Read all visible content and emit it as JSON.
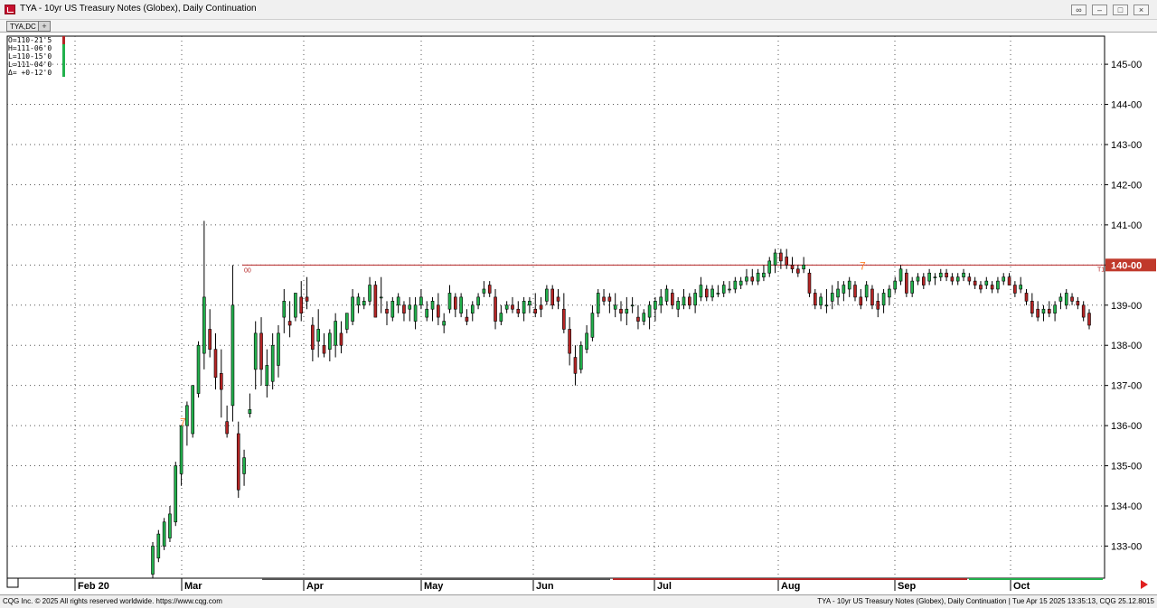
{
  "window": {
    "title": "TYA - 10yr US Treasury Notes (Globex), Daily Continuation",
    "tab_label": "TYA,DC",
    "tab_add_label": "+"
  },
  "ohlc_readout": [
    "O=110-21'5",
    "H=111-06'0",
    "L=110-15'0",
    "L=111-04'0",
    "Δ= +0-12'0"
  ],
  "status": {
    "left": "CQG Inc. © 2025 All rights reserved worldwide. https://www.cqg.com",
    "right": "TYA - 10yr US Treasury Notes (Globex), Daily Continuation | Tue Apr 15 2025 13:35:13, CQG 25.12.8015"
  },
  "colors": {
    "up": "#22b14c",
    "down": "#b52525",
    "line": "#b52525",
    "price_tag": "#c0392b",
    "annotation": "#ff7f27",
    "grid": "#555555"
  },
  "chart_data": {
    "type": "candlestick",
    "title": "",
    "xlabel": "",
    "ylabel": "",
    "ylim": [
      132.2,
      145.7
    ],
    "y_ticks": [
      "133-00",
      "134-00",
      "135-00",
      "136-00",
      "137-00",
      "138-00",
      "139-00",
      "140-00",
      "141-00",
      "142-00",
      "143-00",
      "144-00",
      "145-00"
    ],
    "x_labels": [
      "Feb 20",
      "Mar",
      "Apr",
      "May",
      "Jun",
      "Jul",
      "Aug",
      "Sep",
      "Oct"
    ],
    "grid": true,
    "horizontal_line": {
      "value": 140.0,
      "label": "140-00",
      "left_label": "00",
      "right_label": "T1"
    },
    "annotations": [
      {
        "text": "7",
        "near": "mid Mar",
        "value": 136.1
      },
      {
        "text": "7",
        "near": "mid Aug",
        "value": 140.0
      }
    ],
    "candles": [
      [
        132.3,
        133.1,
        132.2,
        133.0
      ],
      [
        132.7,
        133.4,
        132.6,
        133.3
      ],
      [
        133.0,
        133.7,
        132.9,
        133.6
      ],
      [
        133.2,
        134.0,
        133.1,
        133.8
      ],
      [
        133.6,
        135.1,
        133.5,
        135.0
      ],
      [
        134.8,
        136.0,
        134.5,
        136.0
      ],
      [
        136.0,
        136.6,
        135.5,
        136.5
      ],
      [
        135.8,
        137.0,
        135.7,
        137.0
      ],
      [
        136.8,
        138.1,
        136.7,
        138.0
      ],
      [
        137.8,
        141.1,
        137.4,
        139.2
      ],
      [
        138.4,
        138.9,
        137.7,
        137.9
      ],
      [
        137.9,
        138.3,
        136.9,
        137.2
      ],
      [
        137.3,
        137.9,
        136.2,
        136.9
      ],
      [
        136.1,
        136.5,
        135.7,
        135.8
      ],
      [
        136.5,
        140.0,
        136.1,
        139.0
      ],
      [
        135.8,
        136.1,
        134.2,
        134.4
      ],
      [
        134.8,
        135.4,
        134.5,
        135.2
      ],
      [
        136.3,
        136.8,
        136.2,
        136.4
      ],
      [
        137.4,
        138.6,
        136.9,
        138.3
      ],
      [
        138.3,
        138.7,
        137.0,
        137.4
      ],
      [
        137.0,
        137.9,
        136.7,
        137.5
      ],
      [
        137.1,
        138.3,
        136.9,
        138.0
      ],
      [
        137.5,
        138.5,
        137.2,
        138.3
      ],
      [
        138.7,
        139.4,
        138.3,
        139.1
      ],
      [
        138.6,
        139.1,
        138.2,
        138.5
      ],
      [
        138.7,
        139.3,
        138.6,
        139.3
      ],
      [
        139.2,
        139.6,
        138.6,
        138.8
      ],
      [
        139.2,
        139.7,
        138.9,
        139.1
      ],
      [
        138.5,
        138.7,
        137.6,
        137.9
      ],
      [
        138.1,
        138.9,
        137.7,
        138.4
      ],
      [
        138.0,
        138.3,
        137.7,
        137.8
      ],
      [
        137.9,
        138.4,
        137.6,
        138.3
      ],
      [
        138.0,
        138.8,
        137.7,
        138.6
      ],
      [
        138.3,
        138.6,
        137.8,
        138.0
      ],
      [
        138.4,
        138.8,
        138.3,
        138.8
      ],
      [
        138.6,
        139.4,
        138.5,
        139.2
      ],
      [
        139.0,
        139.3,
        138.8,
        139.2
      ],
      [
        139.0,
        139.2,
        138.9,
        139.1
      ],
      [
        139.1,
        139.7,
        139.0,
        139.5
      ],
      [
        139.5,
        139.6,
        138.7,
        138.7
      ],
      [
        139.2,
        139.7,
        138.8,
        139.2
      ],
      [
        138.9,
        139.1,
        138.5,
        138.8
      ],
      [
        138.7,
        139.2,
        138.6,
        139.1
      ],
      [
        139.0,
        139.3,
        138.8,
        139.2
      ],
      [
        139.0,
        139.1,
        138.6,
        138.8
      ],
      [
        138.9,
        139.2,
        138.6,
        139.0
      ],
      [
        138.6,
        139.2,
        138.4,
        139.0
      ],
      [
        139.0,
        139.4,
        138.9,
        139.2
      ],
      [
        138.7,
        139.1,
        138.6,
        138.9
      ],
      [
        138.9,
        139.2,
        138.6,
        139.1
      ],
      [
        139.0,
        139.3,
        138.5,
        138.7
      ],
      [
        138.5,
        138.8,
        138.3,
        138.6
      ],
      [
        138.9,
        139.5,
        138.8,
        139.3
      ],
      [
        139.2,
        139.3,
        138.7,
        138.9
      ],
      [
        138.8,
        139.3,
        138.7,
        139.2
      ],
      [
        138.7,
        138.9,
        138.5,
        138.6
      ],
      [
        138.8,
        139.1,
        138.6,
        139.0
      ],
      [
        139.0,
        139.3,
        138.9,
        139.2
      ],
      [
        139.3,
        139.6,
        139.2,
        139.4
      ],
      [
        139.5,
        139.6,
        139.2,
        139.3
      ],
      [
        139.2,
        139.4,
        138.4,
        138.6
      ],
      [
        138.6,
        139.0,
        138.5,
        138.8
      ],
      [
        138.9,
        139.1,
        138.8,
        139.0
      ],
      [
        139.0,
        139.2,
        138.8,
        138.9
      ],
      [
        138.9,
        139.1,
        138.7,
        138.8
      ],
      [
        138.8,
        139.2,
        138.6,
        139.1
      ],
      [
        139.0,
        139.2,
        138.8,
        139.1
      ],
      [
        138.9,
        139.3,
        138.7,
        138.8
      ],
      [
        139.0,
        139.2,
        138.7,
        138.9
      ],
      [
        139.1,
        139.5,
        139.0,
        139.4
      ],
      [
        139.4,
        139.5,
        138.9,
        139.0
      ],
      [
        139.2,
        139.4,
        138.9,
        139.1
      ],
      [
        138.9,
        139.3,
        138.3,
        138.4
      ],
      [
        138.4,
        138.7,
        137.5,
        137.8
      ],
      [
        137.7,
        138.0,
        137.0,
        137.3
      ],
      [
        137.4,
        138.1,
        137.3,
        138.0
      ],
      [
        137.9,
        138.5,
        137.8,
        138.3
      ],
      [
        138.2,
        139.0,
        138.1,
        138.8
      ],
      [
        138.8,
        139.4,
        138.7,
        139.3
      ],
      [
        139.2,
        139.4,
        139.0,
        139.1
      ],
      [
        139.2,
        139.3,
        138.8,
        139.1
      ],
      [
        138.9,
        139.3,
        138.7,
        139.0
      ],
      [
        138.9,
        139.1,
        138.6,
        138.8
      ],
      [
        138.8,
        139.2,
        138.5,
        138.9
      ],
      [
        139.0,
        139.2,
        138.8,
        139.0
      ],
      [
        138.7,
        139.0,
        138.4,
        138.6
      ],
      [
        138.6,
        138.9,
        138.5,
        138.8
      ],
      [
        138.7,
        139.1,
        138.4,
        139.0
      ],
      [
        138.9,
        139.2,
        138.6,
        139.1
      ],
      [
        139.0,
        139.4,
        138.8,
        139.2
      ],
      [
        139.1,
        139.5,
        139.0,
        139.4
      ],
      [
        139.3,
        139.4,
        138.9,
        139.0
      ],
      [
        138.9,
        139.2,
        138.7,
        139.1
      ],
      [
        139.0,
        139.4,
        138.9,
        139.2
      ],
      [
        139.2,
        139.3,
        138.9,
        139.0
      ],
      [
        139.0,
        139.4,
        138.8,
        139.3
      ],
      [
        139.2,
        139.7,
        139.1,
        139.5
      ],
      [
        139.4,
        139.5,
        139.1,
        139.2
      ],
      [
        139.2,
        139.5,
        139.1,
        139.4
      ],
      [
        139.3,
        139.5,
        139.2,
        139.3
      ],
      [
        139.3,
        139.6,
        139.2,
        139.5
      ],
      [
        139.4,
        139.6,
        139.3,
        139.4
      ],
      [
        139.4,
        139.7,
        139.3,
        139.6
      ],
      [
        139.5,
        139.7,
        139.4,
        139.6
      ],
      [
        139.6,
        139.9,
        139.5,
        139.7
      ],
      [
        139.7,
        139.9,
        139.5,
        139.6
      ],
      [
        139.6,
        139.9,
        139.5,
        139.8
      ],
      [
        139.7,
        140.0,
        139.6,
        139.8
      ],
      [
        139.8,
        140.2,
        139.7,
        140.1
      ],
      [
        140.0,
        140.4,
        139.8,
        140.3
      ],
      [
        140.3,
        140.4,
        139.9,
        140.1
      ],
      [
        140.2,
        140.4,
        139.9,
        140.0
      ],
      [
        140.0,
        140.2,
        139.8,
        139.9
      ],
      [
        139.9,
        140.0,
        139.7,
        139.8
      ],
      [
        139.9,
        140.2,
        139.8,
        140.0
      ],
      [
        139.8,
        139.9,
        139.2,
        139.3
      ],
      [
        139.3,
        139.4,
        138.9,
        139.0
      ],
      [
        139.0,
        139.3,
        138.9,
        139.2
      ],
      [
        139.0,
        139.4,
        138.8,
        139.0
      ],
      [
        139.1,
        139.5,
        138.9,
        139.3
      ],
      [
        139.2,
        139.6,
        139.0,
        139.4
      ],
      [
        139.3,
        139.6,
        139.1,
        139.5
      ],
      [
        139.4,
        139.7,
        139.2,
        139.6
      ],
      [
        139.5,
        139.6,
        139.1,
        139.2
      ],
      [
        139.2,
        139.4,
        138.9,
        139.0
      ],
      [
        139.2,
        139.6,
        139.1,
        139.5
      ],
      [
        139.4,
        139.5,
        138.9,
        139.0
      ],
      [
        139.1,
        139.3,
        138.7,
        138.9
      ],
      [
        139.0,
        139.4,
        138.8,
        139.3
      ],
      [
        139.2,
        139.5,
        139.0,
        139.4
      ],
      [
        139.4,
        139.7,
        139.3,
        139.6
      ],
      [
        139.6,
        140.0,
        139.5,
        139.9
      ],
      [
        139.8,
        139.9,
        139.2,
        139.3
      ],
      [
        139.3,
        139.7,
        139.2,
        139.6
      ],
      [
        139.6,
        139.8,
        139.5,
        139.7
      ],
      [
        139.7,
        139.8,
        139.4,
        139.5
      ],
      [
        139.6,
        139.9,
        139.5,
        139.8
      ],
      [
        139.7,
        139.8,
        139.5,
        139.7
      ],
      [
        139.7,
        139.9,
        139.6,
        139.8
      ],
      [
        139.8,
        139.9,
        139.6,
        139.7
      ],
      [
        139.7,
        139.8,
        139.5,
        139.6
      ],
      [
        139.6,
        139.8,
        139.5,
        139.7
      ],
      [
        139.7,
        139.9,
        139.6,
        139.8
      ],
      [
        139.7,
        139.8,
        139.5,
        139.6
      ],
      [
        139.6,
        139.7,
        139.4,
        139.5
      ],
      [
        139.5,
        139.6,
        139.3,
        139.4
      ],
      [
        139.5,
        139.7,
        139.4,
        139.6
      ],
      [
        139.5,
        139.6,
        139.3,
        139.4
      ],
      [
        139.4,
        139.7,
        139.3,
        139.6
      ],
      [
        139.6,
        139.8,
        139.5,
        139.7
      ],
      [
        139.7,
        139.8,
        139.5,
        139.5
      ],
      [
        139.5,
        139.6,
        139.2,
        139.3
      ],
      [
        139.4,
        139.7,
        139.3,
        139.5
      ],
      [
        139.3,
        139.4,
        139.0,
        139.1
      ],
      [
        139.1,
        139.3,
        138.7,
        138.8
      ],
      [
        138.9,
        139.1,
        138.6,
        138.7
      ],
      [
        138.8,
        139.0,
        138.6,
        138.9
      ],
      [
        138.9,
        139.1,
        138.7,
        138.8
      ],
      [
        138.8,
        139.1,
        138.6,
        139.0
      ],
      [
        139.1,
        139.3,
        138.9,
        139.2
      ],
      [
        139.0,
        139.4,
        138.9,
        139.3
      ],
      [
        139.2,
        139.3,
        139.0,
        139.1
      ],
      [
        139.1,
        139.2,
        138.9,
        139.0
      ],
      [
        139.0,
        139.1,
        138.6,
        138.7
      ],
      [
        138.8,
        138.9,
        138.4,
        138.5
      ]
    ]
  }
}
